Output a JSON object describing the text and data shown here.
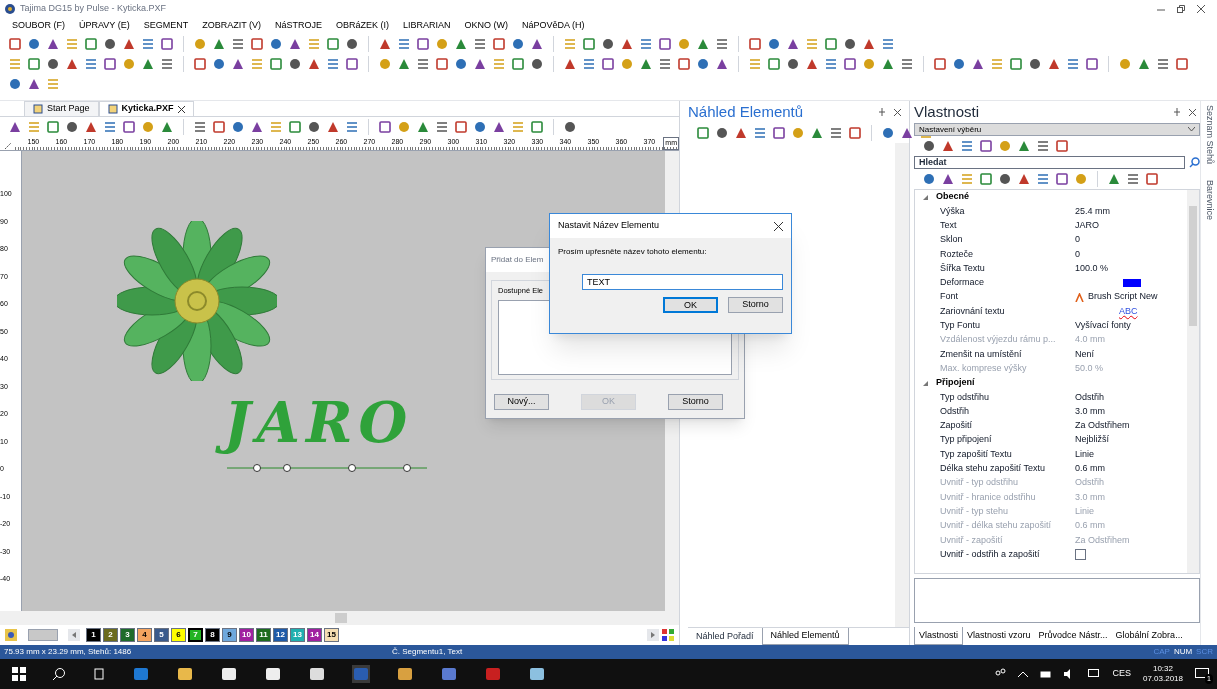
{
  "window": {
    "title": "Tajima DG15 by Pulse - Kyticka.PXF"
  },
  "menu": [
    "SOUBOR (F)",
    "ÚPRAVY (E)",
    "SEGMENT",
    "ZOBRAZIT (V)",
    "NáSTROJE",
    "OBRáZEK (I)",
    "LIBRARIAN",
    "OKNO (W)",
    "NáPOVěDA (H)"
  ],
  "doc_tabs": [
    {
      "label": "Start Page",
      "selected": false,
      "closable": false
    },
    {
      "label": "Kyticka.PXF",
      "selected": true,
      "closable": true
    }
  ],
  "ruler": {
    "unit": "mm",
    "x_labels": [
      "150",
      "160",
      "170",
      "180",
      "190",
      "200",
      "210",
      "220",
      "230",
      "240",
      "250",
      "260",
      "270",
      "280",
      "290",
      "300",
      "310",
      "320",
      "330",
      "340",
      "350",
      "360",
      "370"
    ],
    "y_labels": [
      "100",
      "90",
      "80",
      "70",
      "60",
      "50",
      "40",
      "30",
      "20",
      "10",
      "0",
      "-10",
      "-20",
      "-30",
      "-40"
    ]
  },
  "canvas": {
    "design_text": "JARO"
  },
  "palette": [
    {
      "label": "1",
      "color": "#000000",
      "selected": false
    },
    {
      "label": "2",
      "color": "#6b6b1e",
      "selected": false
    },
    {
      "label": "3",
      "color": "#1e6b2a",
      "selected": false
    },
    {
      "label": "4",
      "color": "#f4a460",
      "selected": false
    },
    {
      "label": "5",
      "color": "#3a5a8c",
      "selected": false
    },
    {
      "label": "6",
      "color": "#ffff00",
      "selected": false
    },
    {
      "label": "7",
      "color": "#22b422",
      "selected": true
    },
    {
      "label": "8",
      "color": "#000000",
      "selected": false
    },
    {
      "label": "9",
      "color": "#6fa8dc",
      "selected": false
    },
    {
      "label": "10",
      "color": "#a020a0",
      "selected": false
    },
    {
      "label": "11",
      "color": "#1e6b1e",
      "selected": false
    },
    {
      "label": "12",
      "color": "#1e5aa8",
      "selected": false
    },
    {
      "label": "13",
      "color": "#20b0b0",
      "selected": false
    },
    {
      "label": "14",
      "color": "#a020a0",
      "selected": false
    },
    {
      "label": "15",
      "color": "#f5deb3",
      "selected": false
    }
  ],
  "add_dialog": {
    "title": "Přidat do Elem",
    "group": "Dostupné Ele",
    "buttons": [
      {
        "label": "Nový...",
        "disabled": false
      },
      {
        "label": "OK",
        "disabled": true
      },
      {
        "label": "Storno",
        "disabled": false
      }
    ]
  },
  "name_dialog": {
    "title": "Nastavit Název Elementu",
    "prompt": "Prosím upřesněte název tohoto elementu:",
    "value": "TEXT",
    "buttons": [
      {
        "label": "OK",
        "default": true
      },
      {
        "label": "Storno",
        "default": false
      }
    ]
  },
  "elements_panel": {
    "title": "Náhled Elementů",
    "tabs": [
      {
        "label": "Náhled Pořadí",
        "selected": false
      },
      {
        "label": "Náhled Elementů",
        "selected": true
      }
    ]
  },
  "properties_panel": {
    "title": "Vlastnosti",
    "selector": "Nastavení výběru",
    "search": {
      "placeholder": "Hledat"
    },
    "groups": [
      {
        "title": "Obecné",
        "expanded": true,
        "rows": [
          {
            "name": "Výška",
            "value": "25.4 mm",
            "kind": "text",
            "disabled": false
          },
          {
            "name": "Text",
            "value": "JARO",
            "kind": "text",
            "disabled": false
          },
          {
            "name": "Sklon",
            "value": "0",
            "kind": "text",
            "disabled": false
          },
          {
            "name": "Rozteče",
            "value": "0",
            "kind": "text",
            "disabled": false
          },
          {
            "name": "Šířka Textu",
            "value": "100.0 %",
            "kind": "text",
            "disabled": false
          },
          {
            "name": "Deformace",
            "kind": "swatch",
            "color": "#0000ff",
            "disabled": false
          },
          {
            "name": "Font",
            "value": "Brush Script New",
            "kind": "font",
            "disabled": false
          },
          {
            "name": "Zariovnání textu",
            "value": "ABC",
            "kind": "align",
            "disabled": false
          },
          {
            "name": "Typ Fontu",
            "value": "Vyšívací fonty",
            "kind": "text",
            "disabled": false
          },
          {
            "name": "Vzdálenost výjezdu rámu p...",
            "value": "4.0 mm",
            "kind": "text",
            "disabled": true
          },
          {
            "name": "Zmenšit na umístění",
            "value": "Není",
            "kind": "text",
            "disabled": false
          },
          {
            "name": "Max. komprese výšky",
            "value": "50.0 %",
            "kind": "text",
            "disabled": true
          }
        ]
      },
      {
        "title": "Připojení",
        "expanded": true,
        "rows": [
          {
            "name": "Typ odstřihu",
            "value": "Odstřih",
            "kind": "text",
            "disabled": false
          },
          {
            "name": "Odstřih",
            "value": "3.0 mm",
            "kind": "text",
            "disabled": false
          },
          {
            "name": "Zapošití",
            "value": "Za Odstřihem",
            "kind": "text",
            "disabled": false
          },
          {
            "name": "Typ připojení",
            "value": "Nejbližší",
            "kind": "text",
            "disabled": false
          },
          {
            "name": "Typ zapošití Textu",
            "value": "Linie",
            "kind": "text",
            "disabled": false
          },
          {
            "name": "Délka stehu zapošití Textu",
            "value": "0.6 mm",
            "kind": "text",
            "disabled": false
          },
          {
            "name": "Uvnitř - typ odstřihu",
            "value": "Odstřih",
            "kind": "text",
            "disabled": true
          },
          {
            "name": "Uvnitř - hranice odstřihu",
            "value": "3.0 mm",
            "kind": "text",
            "disabled": true
          },
          {
            "name": "Uvnitř - typ stehu",
            "value": "Linie",
            "kind": "text",
            "disabled": true
          },
          {
            "name": "Uvnitř - délka stehu zapošití",
            "value": "0.6 mm",
            "kind": "text",
            "disabled": true
          },
          {
            "name": "Uvnitř - zapošití",
            "value": "Za Odstřihem",
            "kind": "text",
            "disabled": true
          },
          {
            "name": "Uvnitř - odstřih a zapošití",
            "kind": "checkbox",
            "checked": false,
            "disabled": false
          }
        ]
      }
    ],
    "tabs": [
      {
        "label": "Vlastnosti",
        "selected": true
      },
      {
        "label": "Vlastnosti vzoru",
        "selected": false
      },
      {
        "label": "Průvodce Nástr...",
        "selected": false
      },
      {
        "label": "Globální Zobra...",
        "selected": false
      }
    ]
  },
  "side_tabs": [
    "Seznam Stehů",
    "Barevnice"
  ],
  "status_bar": {
    "left": "75.93 mm x 23.29 mm, Stehů: 1486",
    "center": "Č. Segmentu1, Text",
    "indicators": [
      {
        "label": "CAP",
        "on": false
      },
      {
        "label": "NUM",
        "on": true
      },
      {
        "label": "SCR",
        "on": false
      }
    ]
  },
  "taskbar": {
    "language": "CES",
    "time": "10:32",
    "date": "07.03.2018",
    "notifications": "1"
  }
}
